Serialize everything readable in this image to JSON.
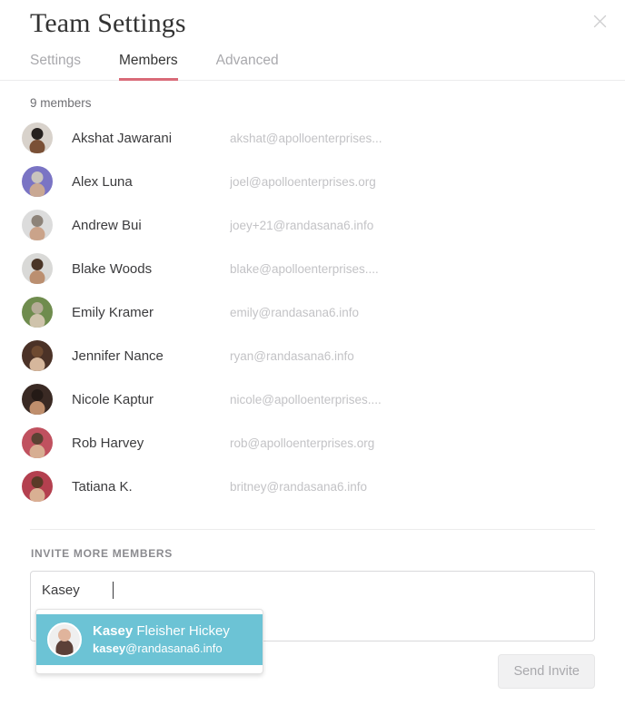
{
  "header": {
    "title": "Team Settings",
    "close_label": "×",
    "tabs": [
      {
        "label": "Settings",
        "active": false
      },
      {
        "label": "Members",
        "active": true
      },
      {
        "label": "Advanced",
        "active": false
      }
    ],
    "active_tab_color": "#d96a78"
  },
  "members_section": {
    "count_label": "9 members",
    "members": [
      {
        "name": "Akshat Jawarani",
        "email": "akshat@apolloenterprises...",
        "avatar_bg": "#d8d2cb",
        "skin": "#7a5036",
        "hair": "#26211f"
      },
      {
        "name": "Alex Luna",
        "email": "joel@apolloenterprises.org",
        "avatar_bg": "#7a74c4",
        "skin": "#c9a893",
        "hair": "#c9c4bd"
      },
      {
        "name": "Andrew Bui",
        "email": "joey+21@randasana6.info",
        "avatar_bg": "#dcdcdc",
        "skin": "#caa38a",
        "hair": "#8d8379"
      },
      {
        "name": "Blake Woods",
        "email": "blake@apolloenterprises....",
        "avatar_bg": "#d9d9d7",
        "skin": "#bb8f70",
        "hair": "#4a3527"
      },
      {
        "name": "Emily Kramer",
        "email": "emily@randasana6.info",
        "avatar_bg": "#6f8c4e",
        "skin": "#cfc3ab",
        "hair": "#b5ac97"
      },
      {
        "name": "Jennifer Nance",
        "email": "ryan@randasana6.info",
        "avatar_bg": "#4b3227",
        "skin": "#d6b79c",
        "hair": "#6e4a31"
      },
      {
        "name": "Nicole Kaptur",
        "email": "nicole@apolloenterprises....",
        "avatar_bg": "#3a2a24",
        "skin": "#c08f6d",
        "hair": "#241a16"
      },
      {
        "name": "Rob Harvey",
        "email": "rob@apolloenterprises.org",
        "avatar_bg": "#c0515f",
        "skin": "#d7ae92",
        "hair": "#5b4233"
      },
      {
        "name": "Tatiana K.",
        "email": "britney@randasana6.info",
        "avatar_bg": "#b4404f",
        "skin": "#d9b093",
        "hair": "#5a3a27"
      }
    ]
  },
  "invite_section": {
    "label": "INVITE MORE MEMBERS",
    "input_value": "Kasey",
    "input_placeholder": "",
    "autocomplete": {
      "visible": true,
      "highlight_color": "#6cc3d5",
      "items": [
        {
          "match": "Kasey",
          "name_rest": " Fleisher Hickey",
          "email_match": "kasey",
          "email_rest": "@randasana6.info"
        }
      ]
    }
  },
  "footer": {
    "send_invite_label": "Send Invite",
    "send_invite_disabled": true
  }
}
